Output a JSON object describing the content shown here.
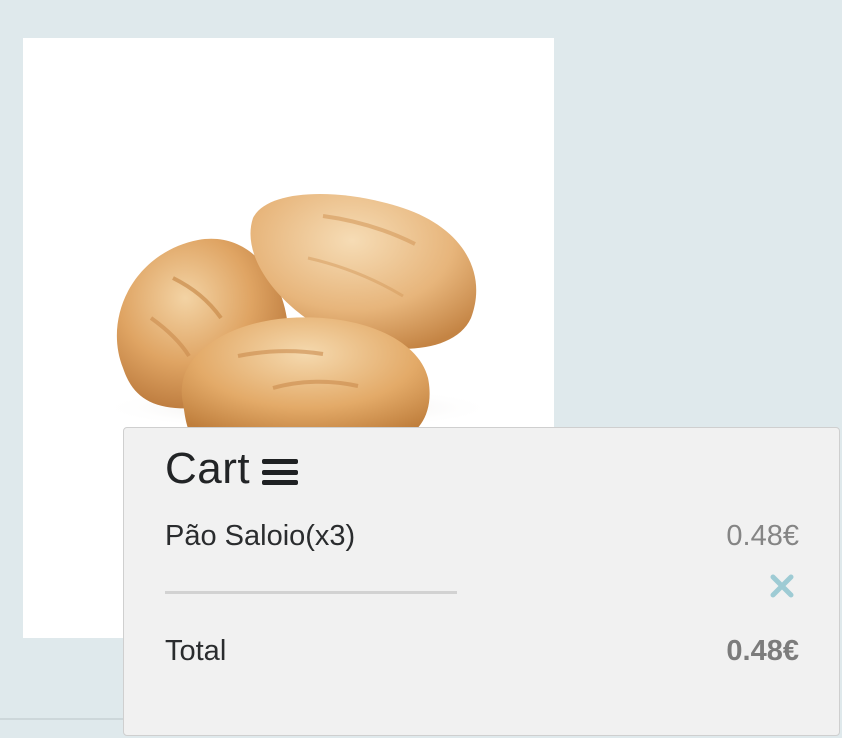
{
  "product": {
    "image_icon": "bread-rolls-image"
  },
  "cart": {
    "title": "Cart",
    "menu_icon": "hamburger-menu-icon",
    "items": [
      {
        "name": "Pão Saloio(x3)",
        "price": "0.48€",
        "remove_icon": "close-x-icon"
      }
    ],
    "total_label": "Total",
    "total_value": "0.48€"
  },
  "colors": {
    "background": "#dfe9ec",
    "panel": "#f1f1f1",
    "remove_icon": "#9ecbd4",
    "price_text": "#858585"
  }
}
